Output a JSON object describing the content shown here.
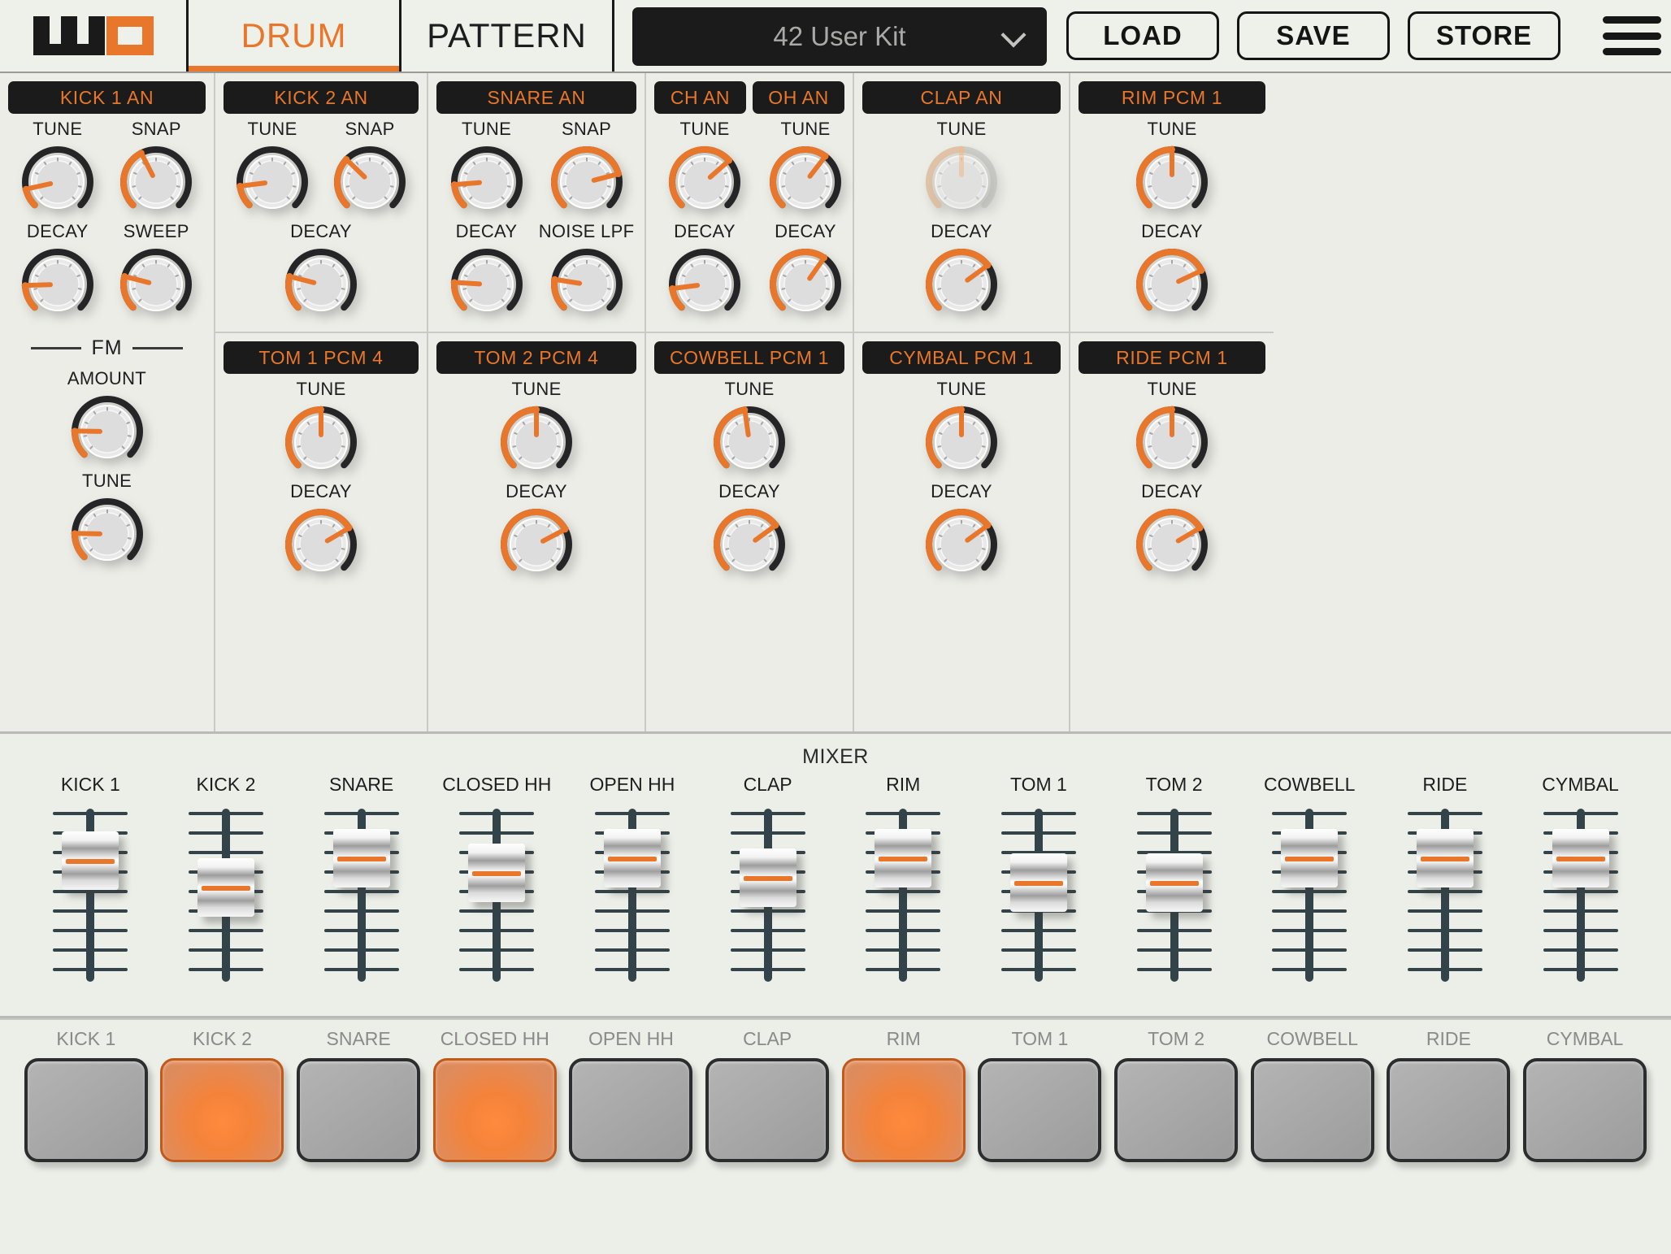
{
  "header": {
    "logo_alt": "uno-logo",
    "tabs": [
      {
        "label": "DRUM",
        "active": true
      },
      {
        "label": "PATTERN",
        "active": false
      }
    ],
    "preset": {
      "value": "42 User Kit",
      "chevron": "chevron-down-icon"
    },
    "buttons": [
      {
        "label": "LOAD"
      },
      {
        "label": "SAVE"
      },
      {
        "label": "STORE"
      }
    ],
    "menu_icon": "hamburger-menu-icon"
  },
  "synth": {
    "columns": [
      {
        "id": "kick1",
        "panels": [
          {
            "titles": [
              "KICK 1 AN"
            ],
            "knob_rows": [
              [
                {
                  "label": "TUNE",
                  "value": 0.12,
                  "dim": false
                },
                {
                  "label": "SNAP",
                  "value": 0.4,
                  "dim": false
                }
              ],
              [
                {
                  "label": "DECAY",
                  "value": 0.16,
                  "dim": false
                },
                {
                  "label": "SWEEP",
                  "value": 0.22,
                  "dim": false
                }
              ]
            ]
          },
          {
            "fm_label": "FM",
            "knob_rows": [
              [
                {
                  "label": "AMOUNT",
                  "value": 0.17,
                  "dim": false
                }
              ],
              [
                {
                  "label": "TUNE",
                  "value": 0.17,
                  "dim": false
                }
              ]
            ]
          }
        ]
      },
      {
        "id": "kick2",
        "panels": [
          {
            "titles": [
              "KICK 2 AN"
            ],
            "knob_rows": [
              [
                {
                  "label": "TUNE",
                  "value": 0.14,
                  "dim": false
                },
                {
                  "label": "SNAP",
                  "value": 0.33,
                  "dim": false
                }
              ],
              [
                {
                  "label": "DECAY",
                  "value": 0.22,
                  "dim": false
                }
              ]
            ]
          },
          {
            "titles": [
              "TOM 1 PCM 4"
            ],
            "knob_rows": [
              [
                {
                  "label": "TUNE",
                  "value": 0.5,
                  "dim": false
                }
              ],
              [
                {
                  "label": "DECAY",
                  "value": 0.72,
                  "dim": false
                }
              ]
            ]
          }
        ]
      },
      {
        "id": "snare",
        "panels": [
          {
            "titles": [
              "SNARE AN"
            ],
            "knob_rows": [
              [
                {
                  "label": "TUNE",
                  "value": 0.15,
                  "dim": false
                },
                {
                  "label": "SNAP",
                  "value": 0.78,
                  "dim": false
                }
              ],
              [
                {
                  "label": "DECAY",
                  "value": 0.18,
                  "dim": false
                },
                {
                  "label": "NOISE LPF",
                  "value": 0.2,
                  "dim": false
                }
              ]
            ]
          },
          {
            "titles": [
              "TOM 2 PCM 4"
            ],
            "knob_rows": [
              [
                {
                  "label": "TUNE",
                  "value": 0.5,
                  "dim": false
                }
              ],
              [
                {
                  "label": "DECAY",
                  "value": 0.73,
                  "dim": false
                }
              ]
            ]
          }
        ]
      },
      {
        "id": "hats",
        "panels": [
          {
            "titles": [
              "CH AN",
              "OH AN"
            ],
            "split": true,
            "left": {
              "knob_rows": [
                [
                  {
                    "label": "TUNE",
                    "value": 0.68,
                    "dim": false
                  }
                ],
                [
                  {
                    "label": "DECAY",
                    "value": 0.14,
                    "dim": false
                  }
                ]
              ]
            },
            "right": {
              "knob_rows": [
                [
                  {
                    "label": "TUNE",
                    "value": 0.64,
                    "dim": false
                  }
                ],
                [
                  {
                    "label": "DECAY",
                    "value": 0.63,
                    "dim": false
                  }
                ]
              ]
            }
          },
          {
            "titles": [
              "COWBELL PCM 1"
            ],
            "knob_rows": [
              [
                {
                  "label": "TUNE",
                  "value": 0.47,
                  "dim": false
                }
              ],
              [
                {
                  "label": "DECAY",
                  "value": 0.7,
                  "dim": false
                }
              ]
            ]
          }
        ]
      },
      {
        "id": "clap",
        "panels": [
          {
            "titles": [
              "CLAP AN"
            ],
            "knob_rows": [
              [
                {
                  "label": "TUNE",
                  "value": 0.5,
                  "dim": true
                }
              ],
              [
                {
                  "label": "DECAY",
                  "value": 0.7,
                  "dim": false
                }
              ]
            ]
          },
          {
            "titles": [
              "CYMBAL PCM 1"
            ],
            "knob_rows": [
              [
                {
                  "label": "TUNE",
                  "value": 0.5,
                  "dim": false
                }
              ],
              [
                {
                  "label": "DECAY",
                  "value": 0.7,
                  "dim": false
                }
              ]
            ]
          }
        ]
      },
      {
        "id": "rim",
        "panels": [
          {
            "titles": [
              "RIM PCM 1"
            ],
            "knob_rows": [
              [
                {
                  "label": "TUNE",
                  "value": 0.5,
                  "dim": false
                }
              ],
              [
                {
                  "label": "DECAY",
                  "value": 0.74,
                  "dim": false
                }
              ]
            ]
          },
          {
            "titles": [
              "RIDE PCM 1"
            ],
            "knob_rows": [
              [
                {
                  "label": "TUNE",
                  "value": 0.5,
                  "dim": false
                }
              ],
              [
                {
                  "label": "DECAY",
                  "value": 0.72,
                  "dim": false
                }
              ]
            ]
          }
        ]
      }
    ]
  },
  "mixer": {
    "title": "MIXER",
    "channels": [
      {
        "label": "KICK 1",
        "value": 0.8
      },
      {
        "label": "KICK 2",
        "value": 0.58
      },
      {
        "label": "SNARE",
        "value": 0.82
      },
      {
        "label": "CLOSED HH",
        "value": 0.7
      },
      {
        "label": "OPEN HH",
        "value": 0.82
      },
      {
        "label": "CLAP",
        "value": 0.66
      },
      {
        "label": "RIM",
        "value": 0.82
      },
      {
        "label": "TOM 1",
        "value": 0.62
      },
      {
        "label": "TOM 2",
        "value": 0.62
      },
      {
        "label": "COWBELL",
        "value": 0.82
      },
      {
        "label": "RIDE",
        "value": 0.82
      },
      {
        "label": "CYMBAL",
        "value": 0.82
      }
    ]
  },
  "pads": {
    "items": [
      {
        "label": "KICK 1",
        "lit": false
      },
      {
        "label": "KICK 2",
        "lit": true
      },
      {
        "label": "SNARE",
        "lit": false
      },
      {
        "label": "CLOSED HH",
        "lit": true
      },
      {
        "label": "OPEN HH",
        "lit": false
      },
      {
        "label": "CLAP",
        "lit": false
      },
      {
        "label": "RIM",
        "lit": true
      },
      {
        "label": "TOM 1",
        "lit": false
      },
      {
        "label": "TOM 2",
        "lit": false
      },
      {
        "label": "COWBELL",
        "lit": false
      },
      {
        "label": "RIDE",
        "lit": false
      },
      {
        "label": "CYMBAL",
        "lit": false
      }
    ]
  },
  "colors": {
    "accent": "#e8772b",
    "panel_bg": "#ecede7",
    "title_bg": "#1b1b1b",
    "track": "#33434a",
    "pad_off": "#a8a8a8",
    "pad_on": "#f4833a"
  }
}
